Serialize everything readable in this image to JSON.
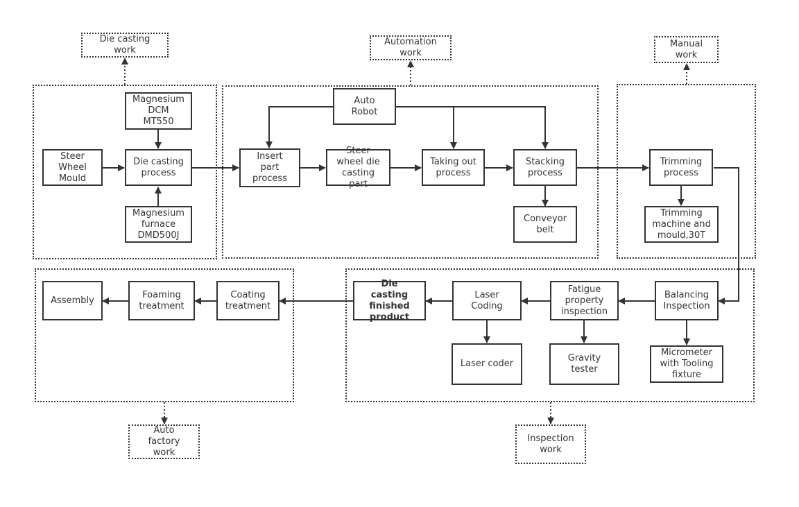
{
  "groups": {
    "die_casting": {
      "label": "Die casting\nwork"
    },
    "automation": {
      "label": "Automation\nwork"
    },
    "manual": {
      "label": "Manual\nwork"
    },
    "auto_factory": {
      "label": "Auto\nfactory\nwork"
    },
    "inspection": {
      "label": "Inspection\nwork"
    }
  },
  "nodes": {
    "magnesium_dcm": "Magnesium\nDCM\nMT550",
    "steer_wheel_mould": "Steer\nWheel\nMould",
    "die_casting_process": "Die casting\nprocess",
    "magnesium_furnace": "Magnesium\nfurnace\nDMD500J",
    "auto_robot": "Auto\nRobot",
    "insert_part": "Insert\npart\nprocess",
    "steer_wheel_die_casting_part": "Steer\nwheel die\ncasting\npart",
    "taking_out": "Taking out\nprocess",
    "stacking": "Stacking\nprocess",
    "conveyor_belt": "Conveyor\nbelt",
    "trimming_process": "Trimming\nprocess",
    "trimming_machine": "Trimming\nmachine and\nmould,30T",
    "balancing_inspection": "Balancing\nInspection",
    "micrometer": "Micrometer\nwith Tooling\nfixture",
    "fatigue": "Fatigue\nproperty\ninspection",
    "gravity_tester": "Gravity\ntester",
    "laser_coding": "Laser\nCoding",
    "laser_coder": "Laser coder",
    "finished_product": "Die\ncasting\nfinished\nproduct",
    "coating": "Coating\ntreatment",
    "foaming": "Foaming\ntreatment",
    "assembly": "Assembly"
  }
}
